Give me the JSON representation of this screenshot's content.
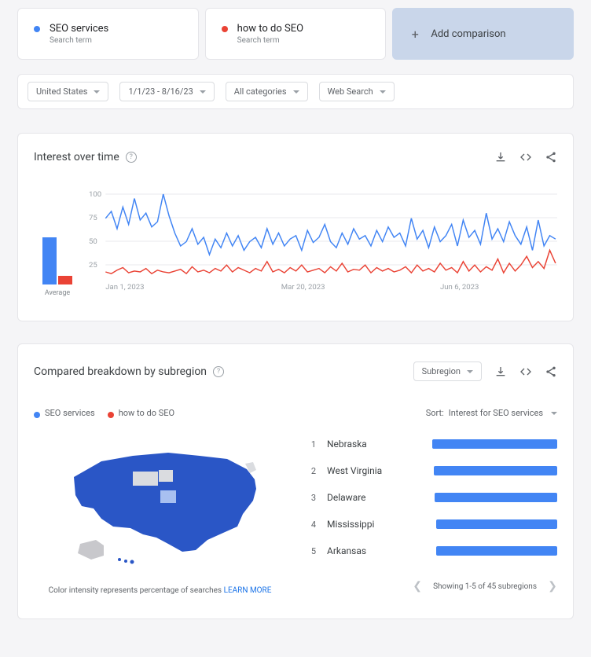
{
  "comparisons": [
    {
      "color": "blue",
      "term": "SEO services",
      "type": "Search term"
    },
    {
      "color": "red",
      "term": "how to do SEO",
      "type": "Search term"
    }
  ],
  "add_comparison_label": "Add comparison",
  "filters": {
    "region": "United States",
    "timeframe": "1/1/23 - 8/16/23",
    "category": "All categories",
    "search_type": "Web Search"
  },
  "interest_panel": {
    "title": "Interest over time",
    "y_ticks": [
      "100",
      "75",
      "50",
      "25"
    ],
    "x_ticks": [
      "Jan 1, 2023",
      "Mar 20, 2023",
      "Jun 6, 2023"
    ],
    "average_label": "Average"
  },
  "chart_data": {
    "type": "line",
    "title": "Interest over time",
    "xlabel": "",
    "ylabel": "",
    "ylim": [
      0,
      100
    ],
    "x_ticks": [
      "Jan 1, 2023",
      "Mar 20, 2023",
      "Jun 6, 2023"
    ],
    "average": {
      "SEO services": 55,
      "how to do SEO": 10
    },
    "series": [
      {
        "name": "SEO services",
        "color": "#4285f4",
        "values": [
          72,
          80,
          60,
          85,
          65,
          95,
          70,
          78,
          62,
          68,
          100,
          75,
          55,
          40,
          45,
          60,
          42,
          50,
          30,
          48,
          38,
          55,
          40,
          52,
          35,
          45,
          50,
          38,
          60,
          42,
          55,
          40,
          48,
          52,
          35,
          58,
          44,
          50,
          65,
          45,
          38,
          55,
          42,
          60,
          48,
          52,
          40,
          58,
          45,
          62,
          50,
          55,
          40,
          72,
          48,
          58,
          38,
          62,
          45,
          52,
          65,
          40,
          70,
          50,
          58,
          42,
          78,
          48,
          60,
          45,
          68,
          52,
          42,
          62,
          35,
          70,
          40,
          52,
          48
        ]
      },
      {
        "name": "how to do SEO",
        "color": "#ea4335",
        "values": [
          10,
          8,
          12,
          15,
          9,
          11,
          10,
          14,
          8,
          12,
          10,
          9,
          11,
          13,
          8,
          16,
          10,
          12,
          9,
          14,
          11,
          18,
          10,
          15,
          12,
          9,
          14,
          11,
          22,
          10,
          13,
          9,
          15,
          11,
          18,
          10,
          12,
          14,
          9,
          16,
          11,
          20,
          10,
          13,
          12,
          18,
          9,
          15,
          11,
          14,
          10,
          12,
          16,
          9,
          18,
          11,
          14,
          10,
          20,
          12,
          15,
          9,
          22,
          11,
          18,
          10,
          16,
          12,
          25,
          9,
          20,
          11,
          18,
          28,
          15,
          22,
          14,
          35,
          20
        ]
      }
    ]
  },
  "breakdown_panel": {
    "title": "Compared breakdown by subregion",
    "selector_label": "Subregion",
    "legend": [
      {
        "color": "blue",
        "label": "SEO services"
      },
      {
        "color": "red",
        "label": "how to do SEO"
      }
    ],
    "sort_label": "Sort:",
    "sort_value": "Interest for SEO services",
    "regions": [
      {
        "rank": "1",
        "name": "Nebraska",
        "pct": 100
      },
      {
        "rank": "2",
        "name": "West Virginia",
        "pct": 99
      },
      {
        "rank": "3",
        "name": "Delaware",
        "pct": 98
      },
      {
        "rank": "4",
        "name": "Mississippi",
        "pct": 97
      },
      {
        "rank": "5",
        "name": "Arkansas",
        "pct": 97
      }
    ],
    "map_note": "Color intensity represents percentage of searches",
    "learn_more": "LEARN MORE",
    "pager_text": "Showing 1-5 of 45 subregions"
  }
}
